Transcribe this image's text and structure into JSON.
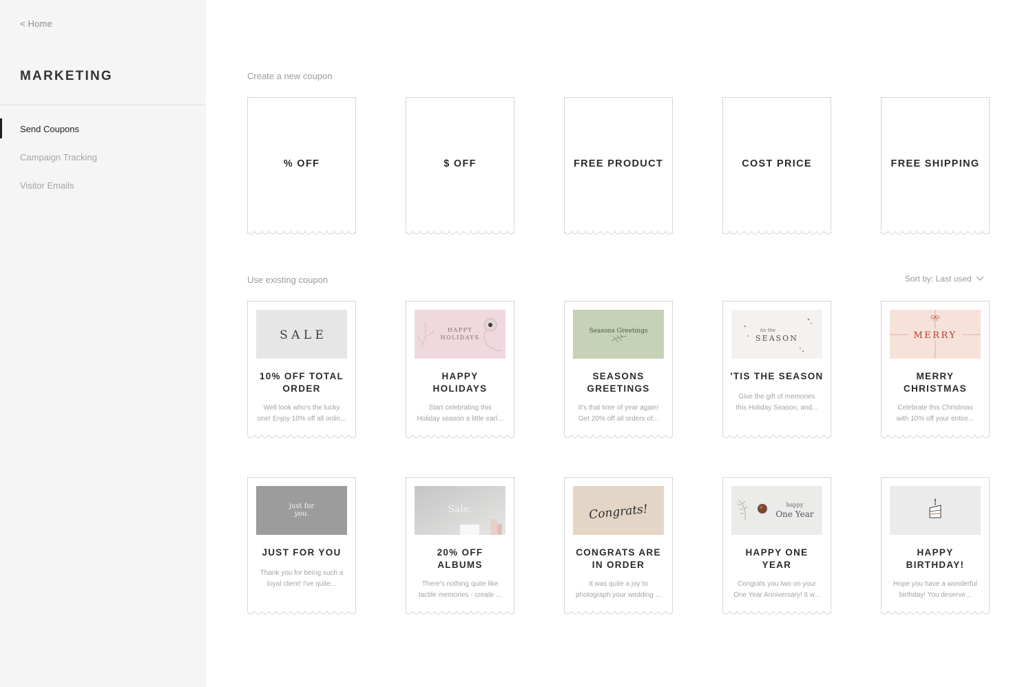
{
  "sidebar": {
    "home_link": "< Home",
    "section_title": "MARKETING",
    "nav": [
      {
        "label": "Send Coupons",
        "active": true
      },
      {
        "label": "Campaign Tracking",
        "active": false
      },
      {
        "label": "Visitor Emails",
        "active": false
      }
    ]
  },
  "main": {
    "new_heading": "Create a new coupon",
    "new_coupons": [
      "% OFF",
      "$ OFF",
      "FREE PRODUCT",
      "COST PRICE",
      "FREE SHIPPING"
    ],
    "existing_heading": "Use existing coupon",
    "sort_label": "Sort by: Last used",
    "existing": [
      {
        "thumb_text": [
          "S A L E"
        ],
        "title": [
          "10% OFF TOTAL",
          "ORDER"
        ],
        "desc": [
          "Well look who's the lucky",
          "one! Enjoy 10% off all onlin..."
        ]
      },
      {
        "thumb_text": [
          "HAPPY",
          "HOLIDAYS"
        ],
        "title": [
          "HAPPY",
          "HOLIDAYS"
        ],
        "desc": [
          "Start celebrating this",
          "Holiday season a little earl..."
        ]
      },
      {
        "thumb_text": [
          "Seasons Greetings"
        ],
        "title": [
          "SEASONS",
          "GREETINGS"
        ],
        "desc": [
          "It's that time of year again!",
          "Get 20% off all orders of..."
        ]
      },
      {
        "thumb_text": [
          "tis the",
          "SEASON"
        ],
        "title": [
          "'TIS THE SEASON"
        ],
        "desc": [
          "Give the gift of memories",
          "this Holiday Season, and..."
        ]
      },
      {
        "thumb_text": [
          "MERRY"
        ],
        "title": [
          "MERRY",
          "CHRISTMAS"
        ],
        "desc": [
          "Celebrate this Christmas",
          "with 10% off your entire..."
        ]
      },
      {
        "thumb_text": [
          "just for",
          "you."
        ],
        "title": [
          "JUST FOR YOU"
        ],
        "desc": [
          "Thank you for being such a",
          "loyal client! I've quite..."
        ]
      },
      {
        "thumb_text": [
          "Sale."
        ],
        "title": [
          "20% OFF",
          "ALBUMS"
        ],
        "desc": [
          "There's nothing quite like",
          "tactile memories - create ..."
        ]
      },
      {
        "thumb_text": [
          "Congrats!"
        ],
        "title": [
          "CONGRATS ARE",
          "IN ORDER"
        ],
        "desc": [
          "It was quite a joy to",
          "photograph your wedding ..."
        ]
      },
      {
        "thumb_text": [
          "happy",
          "One Year"
        ],
        "title": [
          "HAPPY ONE",
          "YEAR"
        ],
        "desc": [
          "Congrats you two on your",
          "One Year Anniversary! It w..."
        ]
      },
      {
        "thumb_text": [],
        "title": [
          "HAPPY",
          "BIRTHDAY!"
        ],
        "desc": [
          "Hope you have a wonderful",
          "birthday! You deserve..."
        ]
      }
    ]
  }
}
